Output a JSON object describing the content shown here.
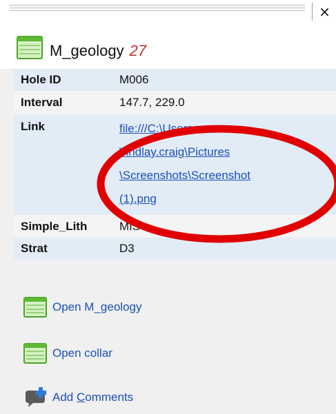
{
  "window": {
    "close_glyph": "×"
  },
  "header": {
    "name": "M_geology",
    "count": "27"
  },
  "fields": [
    {
      "label": "Hole ID",
      "value": "M006"
    },
    {
      "label": "Interval",
      "value": "147.7, 229.0"
    },
    {
      "label": "Link",
      "value_lines": [
        "file:///C:\\Users",
        "\\findlay.craig\\Pictures",
        "\\Screenshots\\Screenshot",
        "(1).png"
      ]
    },
    {
      "label": "Simple_Lith",
      "value": "MIS"
    },
    {
      "label": "Strat",
      "value": "D3"
    }
  ],
  "actions": [
    {
      "label": "Open M_geology",
      "icon": "grid-table-icon"
    },
    {
      "label": "Open collar",
      "icon": "grid-table-icon"
    },
    {
      "label_prefix": "Add ",
      "label_underlined": "C",
      "label_suffix": "omments",
      "icon": "comment-add-icon"
    }
  ],
  "colors": {
    "annotation": "#e00000",
    "link": "#1a4fb8",
    "accent_count": "#c0302e"
  }
}
